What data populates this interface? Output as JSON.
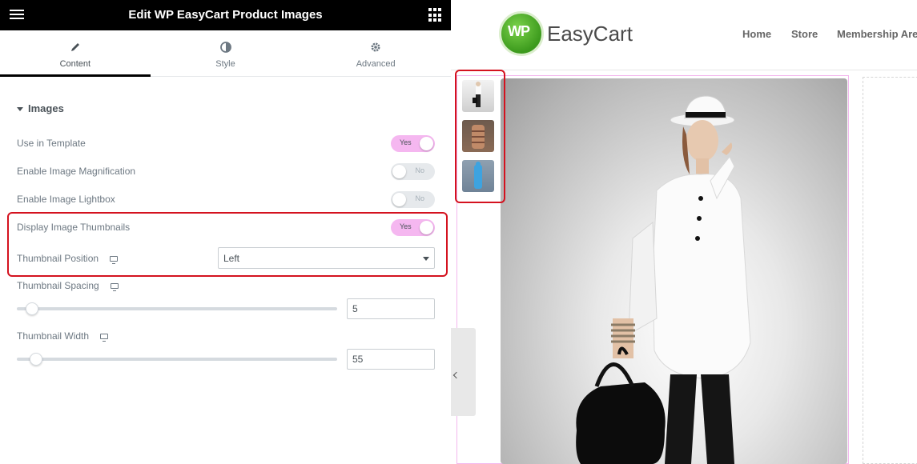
{
  "panel": {
    "title": "Edit WP EasyCart Product Images",
    "tabs": [
      {
        "label": "Content",
        "icon": "pencil-icon",
        "active": true
      },
      {
        "label": "Style",
        "icon": "half-circle-icon",
        "active": false
      },
      {
        "label": "Advanced",
        "icon": "gear-icon",
        "active": false
      }
    ],
    "section": {
      "title": "Images",
      "controls": {
        "use_in_template": {
          "label": "Use in Template",
          "value": "Yes",
          "on": true
        },
        "image_magnification": {
          "label": "Enable Image Magnification",
          "value": "No",
          "on": false
        },
        "image_lightbox": {
          "label": "Enable Image Lightbox",
          "value": "No",
          "on": false
        },
        "display_thumbnails": {
          "label": "Display Image Thumbnails",
          "value": "Yes",
          "on": true
        },
        "thumbnail_position": {
          "label": "Thumbnail Position",
          "value": "Left"
        },
        "thumbnail_spacing": {
          "label": "Thumbnail Spacing",
          "value": "5"
        },
        "thumbnail_width": {
          "label": "Thumbnail Width",
          "value": "55"
        }
      }
    },
    "accent_color": "#f5b7f0",
    "highlight_color": "#d4121f"
  },
  "preview": {
    "logo": {
      "badge": "WP",
      "text": "EasyCart"
    },
    "nav": [
      "Home",
      "Store",
      "Membership Area"
    ]
  }
}
